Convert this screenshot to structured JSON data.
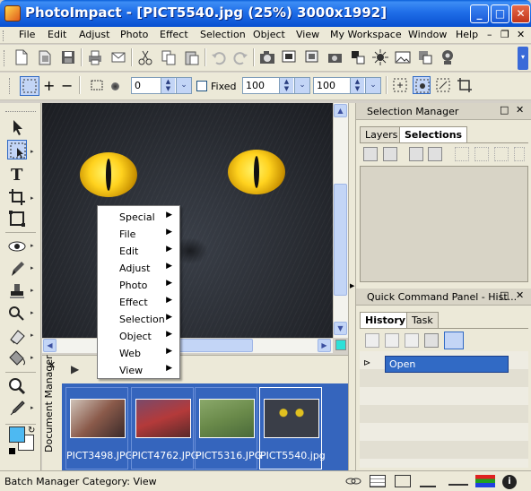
{
  "window": {
    "title": "PhotoImpact - [PICT5540.jpg (25%) 3000x1992]",
    "minimize_label": "_",
    "maximize_label": "□",
    "close_label": "✕"
  },
  "menubar": {
    "items": [
      "File",
      "Edit",
      "Adjust",
      "Photo",
      "Effect",
      "Selection",
      "Object",
      "View",
      "My Workspace",
      "Window",
      "Help"
    ],
    "mdi_controls": [
      "–",
      "❐",
      "✕"
    ]
  },
  "standard_toolbar": {
    "icons": [
      "new-icon",
      "open-icon",
      "save-icon",
      "print-icon",
      "email-icon",
      "cut-icon",
      "copy-icon",
      "paste-icon",
      "undo-icon",
      "redo-icon",
      "camera-icon",
      "scanner-icon",
      "scan-icon",
      "capture-icon",
      "color-icon",
      "brightness-icon",
      "image-icon",
      "convert-icon",
      "webcam-icon"
    ]
  },
  "attribute_toolbar": {
    "fields": [
      {
        "name": "soft-edge",
        "value": "0"
      },
      {
        "name": "width",
        "value": "100"
      },
      {
        "name": "height",
        "value": "100"
      }
    ],
    "fixed_label": "Fixed",
    "fixed_checked": false
  },
  "toolbox": {
    "tools": [
      "pick-tool",
      "selection-tool",
      "text-tool",
      "crop-tool",
      "transform-tool",
      "eye-tool",
      "brush-tool",
      "stamp-tool",
      "clone-tool",
      "eraser-tool",
      "fill-tool",
      "zoom-tool",
      "dropper-tool"
    ],
    "foreground_color": "#4db9f2",
    "background_color": "#ffffff"
  },
  "context_menu": {
    "items": [
      "Special",
      "File",
      "Edit",
      "Adjust",
      "Photo",
      "Effect",
      "Selection",
      "Object",
      "Web",
      "View"
    ]
  },
  "document_manager": {
    "label": "Document Manager",
    "close_label": "✕",
    "thumbnails": [
      {
        "file": "PICT3498.JPG",
        "accent": "#8a5a4a"
      },
      {
        "file": "PICT4762.JPG",
        "accent": "#b43a3a"
      },
      {
        "file": "PICT5316.JPG",
        "accent": "#6a8a4a"
      },
      {
        "file": "PICT5540.jpg",
        "accent": "#3a3e48"
      }
    ]
  },
  "selection_manager": {
    "title": "Selection Manager",
    "tabs": [
      "Layers",
      "Selections"
    ],
    "active_tab": "Selections"
  },
  "quick_command": {
    "title": "Quick Command Panel - Hist...",
    "tabs": [
      "History",
      "Task"
    ],
    "active_tab": "History",
    "history_items": [
      "Open"
    ]
  },
  "statusbar": {
    "text": "Batch Manager Category: View"
  },
  "colors": {
    "accent": "#316ac5",
    "titlebar": "#0a5fd8",
    "eye": "#ffd21e"
  }
}
